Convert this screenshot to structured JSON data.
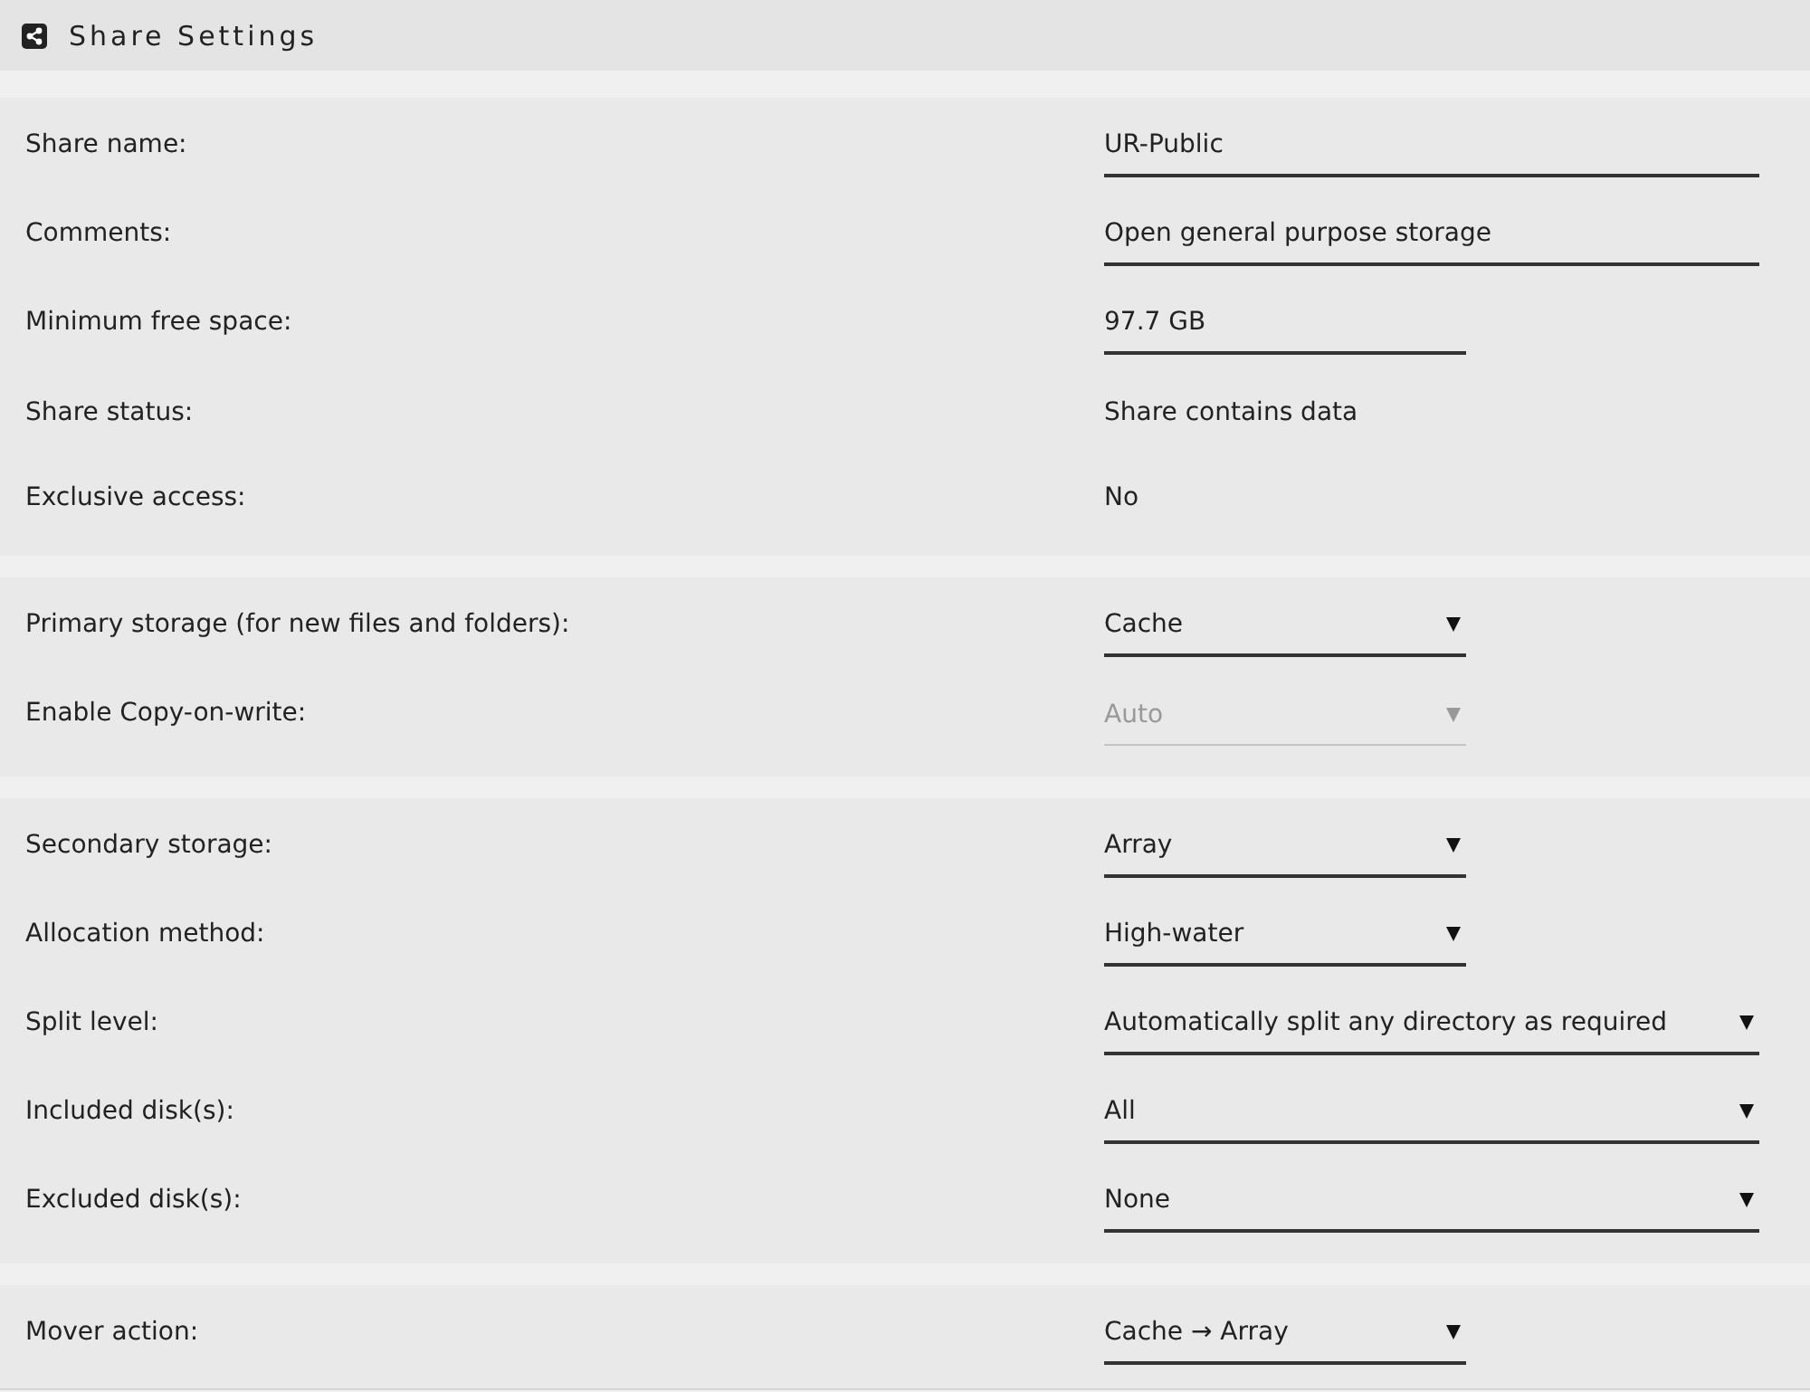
{
  "header": {
    "title": "Share Settings"
  },
  "sections": [
    {
      "rows": [
        {
          "label": "Share name:",
          "kind": "input",
          "value": "UR-Public",
          "disabled": false
        },
        {
          "label": "Comments:",
          "kind": "input",
          "value": "Open general purpose storage",
          "disabled": false
        },
        {
          "label": "Minimum free space:",
          "kind": "shortinput",
          "value": "97.7 GB",
          "disabled": false
        },
        {
          "label": "Share status:",
          "kind": "info",
          "value": "Share contains data",
          "disabled": false
        },
        {
          "label": "Exclusive access:",
          "kind": "info",
          "value": "No",
          "disabled": false
        }
      ]
    },
    {
      "rows": [
        {
          "label": "Primary storage (for new files and folders):",
          "kind": "select",
          "value": "Cache",
          "disabled": false
        },
        {
          "label": "Enable Copy-on-write:",
          "kind": "select",
          "value": "Auto",
          "disabled": true
        }
      ]
    },
    {
      "rows": [
        {
          "label": "Secondary storage:",
          "kind": "select",
          "value": "Array",
          "disabled": false
        },
        {
          "label": "Allocation method:",
          "kind": "select",
          "value": "High-water",
          "disabled": false
        },
        {
          "label": "Split level:",
          "kind": "wideselect",
          "value": "Automatically split any directory as required",
          "disabled": false
        },
        {
          "label": "Included disk(s):",
          "kind": "wideselect",
          "value": "All",
          "disabled": false
        },
        {
          "label": "Excluded disk(s):",
          "kind": "wideselect",
          "value": "None",
          "disabled": false
        }
      ]
    },
    {
      "rows": [
        {
          "label": "Mover action:",
          "kind": "select",
          "value": "Cache → Array",
          "disabled": false
        }
      ]
    }
  ]
}
